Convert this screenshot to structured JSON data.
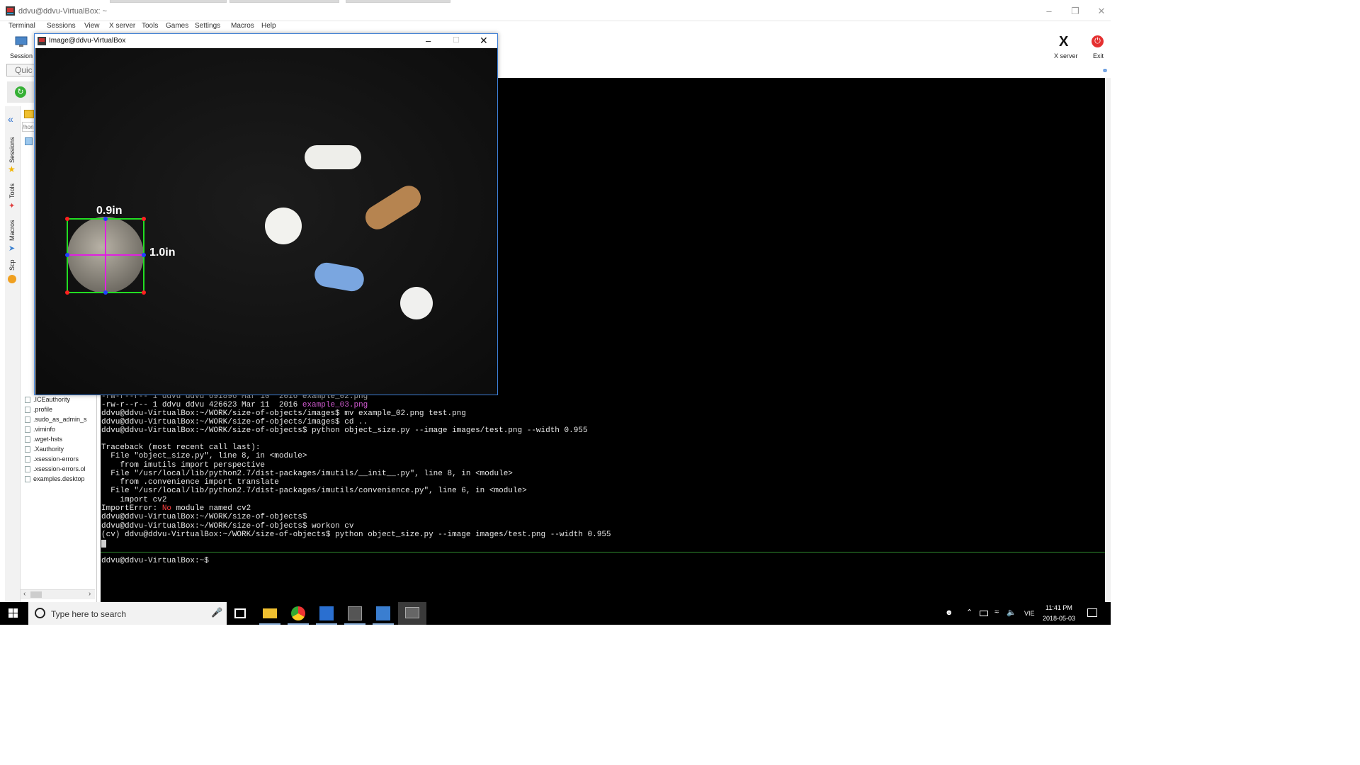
{
  "window": {
    "title": "ddvu@ddvu-VirtualBox: ~"
  },
  "menu": [
    "Terminal",
    "Sessions",
    "View",
    "X server",
    "Tools",
    "Games",
    "Settings",
    "Macros",
    "Help"
  ],
  "toolbar": {
    "session_label": "Session",
    "xserver_label": "X server",
    "exit_label": "Exit",
    "quick_connect_placeholder": "Quic"
  },
  "sidebar": {
    "tabs": [
      "Sessions",
      "Tools",
      "Macros",
      "Scp"
    ],
    "path_placeholder": "/hon",
    "files": [
      ".ICEauthority",
      ".profile",
      ".sudo_as_admin_s",
      ".viminfo",
      ".wget-hsts",
      ".Xauthority",
      ".xsession-errors",
      ".xsession-errors.ol",
      "examples.desktop"
    ]
  },
  "terminal": {
    "lines": [
      {
        "text": "-rw-r--r-- 1 ddvu ddvu 426623 Mar 11  2016 ",
        "colored": "example_03.png"
      },
      {
        "text": "ddvu@ddvu-VirtualBox:~/WORK/size-of-objects/images$ mv example_02.png test.png"
      },
      {
        "text": "ddvu@ddvu-VirtualBox:~/WORK/size-of-objects/images$ cd .."
      },
      {
        "text": "ddvu@ddvu-VirtualBox:~/WORK/size-of-objects$ python object_size.py --image images/test.png --width 0.955"
      },
      {
        "text": ""
      },
      {
        "text": "Traceback (most recent call last):"
      },
      {
        "text": "  File \"object_size.py\", line 8, in <module>"
      },
      {
        "text": "    from imutils import perspective"
      },
      {
        "text": "  File \"/usr/local/lib/python2.7/dist-packages/imutils/__init__.py\", line 8, in <module>"
      },
      {
        "text": "    from .convenience import translate"
      },
      {
        "text": "  File \"/usr/local/lib/python2.7/dist-packages/imutils/convenience.py\", line 6, in <module>"
      },
      {
        "text": "    import cv2"
      },
      {
        "text": "ImportError: ",
        "red": "No",
        "tail": " module named cv2"
      },
      {
        "text": "ddvu@ddvu-VirtualBox:~/WORK/size-of-objects$"
      },
      {
        "text": "ddvu@ddvu-VirtualBox:~/WORK/size-of-objects$ workon cv"
      },
      {
        "text": "(cv) ddvu@ddvu-VirtualBox:~/WORK/size-of-objects$ python object_size.py --image images/test.png --width 0.955"
      }
    ],
    "second_pane_prompt": "ddvu@ddvu-VirtualBox:~$",
    "partial_top_line": "-rw-r--r-- 1 ddvu ddvu 691896 Mar 10  2016 example_02.png"
  },
  "image_window": {
    "title": "Image@ddvu-VirtualBox",
    "width_label": "0.9in",
    "height_label": "1.0in"
  },
  "taskbar": {
    "search_placeholder": "Type here to search",
    "language": "VIE",
    "time": "11:41 PM",
    "date": "2018-05-03"
  },
  "colors": {
    "terminal_bg": "#000000",
    "magenta": "#d05ad0",
    "box_green": "#22dd22",
    "midline_magenta": "#e020e0"
  }
}
